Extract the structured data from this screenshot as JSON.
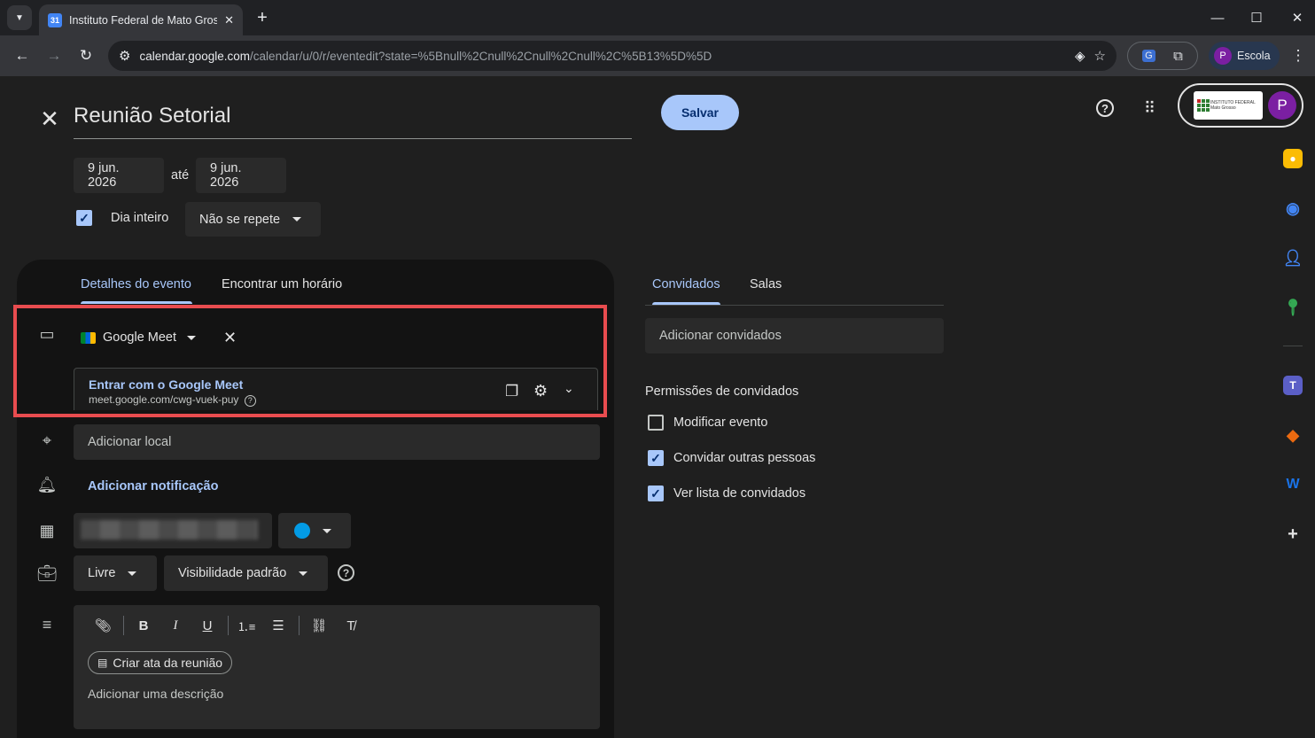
{
  "browser": {
    "tab_title": "Instituto Federal de Mato Grosso",
    "favicon_text": "31",
    "url_host": "calendar.google.com",
    "url_path": "/calendar/u/0/r/eventedit?state=%5Bnull%2Cnull%2Cnull%2Cnull%2C%5B13%5D%5D",
    "profile_label": "Escola",
    "profile_initial": "P"
  },
  "event": {
    "title": "Reunião Setorial",
    "save_label": "Salvar",
    "start_date": "9 jun. 2026",
    "to_label": "até",
    "end_date": "9 jun. 2026",
    "all_day_label": "Dia inteiro",
    "repeat_value": "Não se repete"
  },
  "header": {
    "org_logo_text": "INSTITUTO FEDERAL Mato Grosso",
    "account_initial": "P"
  },
  "left_tabs": {
    "details": "Detalhes do evento",
    "find_time": "Encontrar um horário"
  },
  "meet": {
    "provider_label": "Google Meet",
    "join_label": "Entrar com o Google Meet",
    "link": "meet.google.com/cwg-vuek-puy"
  },
  "fields": {
    "location_placeholder": "Adicionar local",
    "notification_label": "Adicionar notificação",
    "availability_value": "Livre",
    "visibility_value": "Visibilidade padrão",
    "calendar_color": "#039be5",
    "meeting_notes_label": "Criar ata da reunião",
    "description_placeholder": "Adicionar uma descrição"
  },
  "guests_panel": {
    "tab_guests": "Convidados",
    "tab_rooms": "Salas",
    "add_guests_placeholder": "Adicionar convidados",
    "permissions_title": "Permissões de convidados",
    "permissions": [
      {
        "label": "Modificar evento",
        "checked": false
      },
      {
        "label": "Convidar outras pessoas",
        "checked": true
      },
      {
        "label": "Ver lista de convidados",
        "checked": true
      }
    ]
  },
  "colors": {
    "accent": "#a8c7fa",
    "highlight_border": "#e84c4f",
    "background": "#1f1f1f"
  }
}
